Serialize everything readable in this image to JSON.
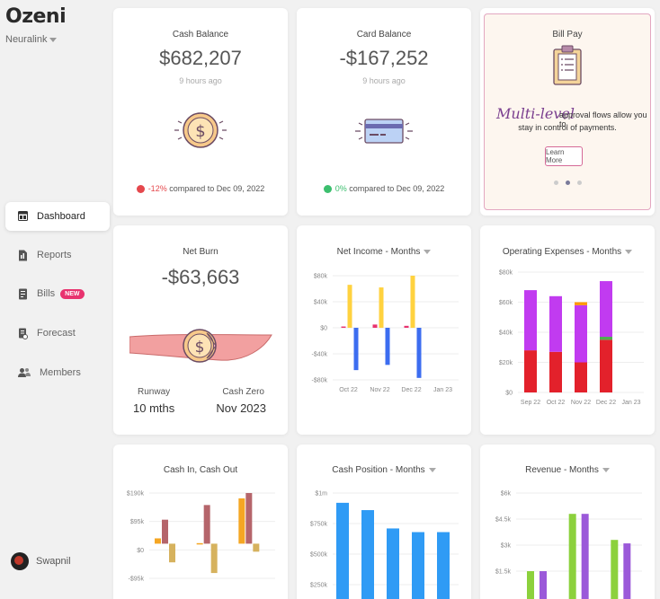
{
  "sidebar": {
    "logo": "Ozeni",
    "org": "Neuralink",
    "items": [
      {
        "label": "Dashboard",
        "icon": "dashboard-icon",
        "active": true
      },
      {
        "label": "Reports",
        "icon": "reports-icon"
      },
      {
        "label": "Bills",
        "icon": "bills-icon",
        "badge": "NEW"
      },
      {
        "label": "Forecast",
        "icon": "forecast-icon"
      },
      {
        "label": "Members",
        "icon": "members-icon"
      }
    ],
    "user": "Swapnil"
  },
  "cash_balance": {
    "title": "Cash Balance",
    "value": "$682,207",
    "updated": "9 hours ago",
    "change": "-12%",
    "compare": "compared to Dec 09, 2022"
  },
  "card_balance": {
    "title": "Card Balance",
    "value": "-$167,252",
    "updated": "9 hours ago",
    "change": "0%",
    "compare": "compared to Dec 09, 2022"
  },
  "bill_pay": {
    "title": "Bill Pay",
    "highlight": "Multi-level",
    "text1": "approval flows allow you to",
    "text2": "stay in control of payments.",
    "button": "Learn More"
  },
  "net_burn": {
    "title": "Net Burn",
    "value": "-$63,663",
    "runway_label": "Runway",
    "runway_value": "10 mths",
    "cash_zero_label": "Cash Zero",
    "cash_zero_value": "Nov 2023"
  },
  "colors": {
    "negative": "#e5484d",
    "positive": "#3cbf6e",
    "accent_pink": "#e8336f"
  },
  "chart_data": [
    {
      "id": "net_income",
      "type": "bar",
      "title": "Net Income - Months",
      "categories": [
        "Oct 22",
        "Nov 22",
        "Dec 22",
        "Jan 23"
      ],
      "yticks": [
        "$80k",
        "$40k",
        "$0",
        "-$40k",
        "-$80k"
      ],
      "ylim": [
        -80000,
        80000
      ],
      "series": [
        {
          "color": "#e8336f",
          "values": [
            2000,
            5000,
            3000,
            0
          ]
        },
        {
          "color": "#ffd23f",
          "values": [
            66000,
            62000,
            80000,
            0
          ]
        },
        {
          "color": "#3c6df0",
          "values": [
            -65000,
            -57000,
            -77000,
            0
          ]
        }
      ]
    },
    {
      "id": "operating_expenses",
      "type": "bar",
      "title": "Operating Expenses - Months",
      "categories": [
        "Sep 22",
        "Oct 22",
        "Nov 22",
        "Dec 22",
        "Jan 23"
      ],
      "yticks": [
        "$80k",
        "$60k",
        "$40k",
        "$20k",
        "$0"
      ],
      "ylim": [
        0,
        80000
      ],
      "stacked": true,
      "series": [
        {
          "color": "#e3212b",
          "values": [
            28000,
            27000,
            20000,
            35000,
            0
          ]
        },
        {
          "color": "#4caf50",
          "values": [
            0,
            0,
            0,
            2000,
            0
          ]
        },
        {
          "color": "#c13bf0",
          "values": [
            40000,
            37000,
            38000,
            37000,
            0
          ]
        },
        {
          "color": "#ff9800",
          "values": [
            0,
            0,
            2000,
            0,
            0
          ]
        }
      ]
    },
    {
      "id": "cash_in_out",
      "type": "bar",
      "title": "Cash In, Cash Out",
      "yticks": [
        "$190k",
        "$95k",
        "$0",
        "-$95k"
      ],
      "ylim": [
        -130000,
        190000
      ],
      "series": [
        {
          "color": "#f5a623",
          "values": [
            20000,
            2000,
            170000
          ]
        },
        {
          "color": "#b5656b",
          "values": [
            90000,
            145000,
            190000
          ]
        },
        {
          "color": "#d6b25e",
          "values": [
            -70000,
            -110000,
            -30000
          ]
        }
      ]
    },
    {
      "id": "cash_position",
      "type": "bar",
      "title": "Cash Position - Months",
      "yticks": [
        "$1m",
        "$750k",
        "$500k",
        "$250k"
      ],
      "ylim": [
        250000,
        1000000
      ],
      "values": [
        920000,
        860000,
        710000,
        680000,
        680000
      ],
      "color": "#2f9bf5"
    },
    {
      "id": "revenue",
      "type": "bar",
      "title": "Revenue - Months",
      "yticks": [
        "$6k",
        "$4.5k",
        "$3k",
        "$1.5k"
      ],
      "ylim": [
        1500,
        6000
      ],
      "series": [
        {
          "color": "#8cd13d",
          "values": [
            1500,
            4800,
            3300
          ]
        },
        {
          "color": "#9b59d9",
          "values": [
            1500,
            4800,
            3100
          ]
        }
      ]
    }
  ]
}
